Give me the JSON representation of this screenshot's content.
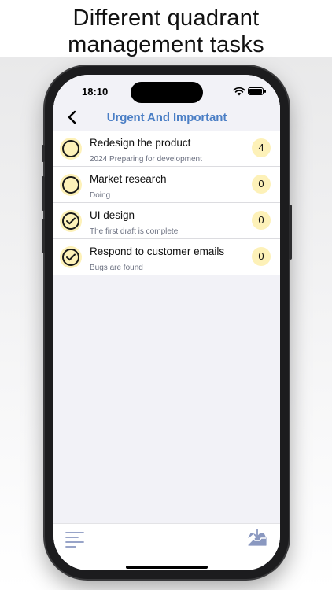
{
  "headline": {
    "line1": "Different quadrant",
    "line2": "management tasks"
  },
  "status_bar": {
    "time": "18:10"
  },
  "nav": {
    "title": "Urgent And Important"
  },
  "tasks": [
    {
      "title": "Redesign the product",
      "subtitle": "2024 Preparing for development",
      "count": "4",
      "completed": false
    },
    {
      "title": "Market research",
      "subtitle": "Doing",
      "count": "0",
      "completed": false
    },
    {
      "title": "UI design",
      "subtitle": "The first draft is complete",
      "count": "0",
      "completed": true
    },
    {
      "title": "Respond to customer emails",
      "subtitle": "Bugs are found",
      "count": "0",
      "completed": true
    }
  ],
  "colors": {
    "accent": "#4a7ec5",
    "badge": "#fdf1b8",
    "screen_bg": "#f2f2f7"
  },
  "icons": {
    "back": "chevron-left-icon",
    "menu": "menu-lines-icon",
    "inbox": "inbox-download-icon"
  }
}
